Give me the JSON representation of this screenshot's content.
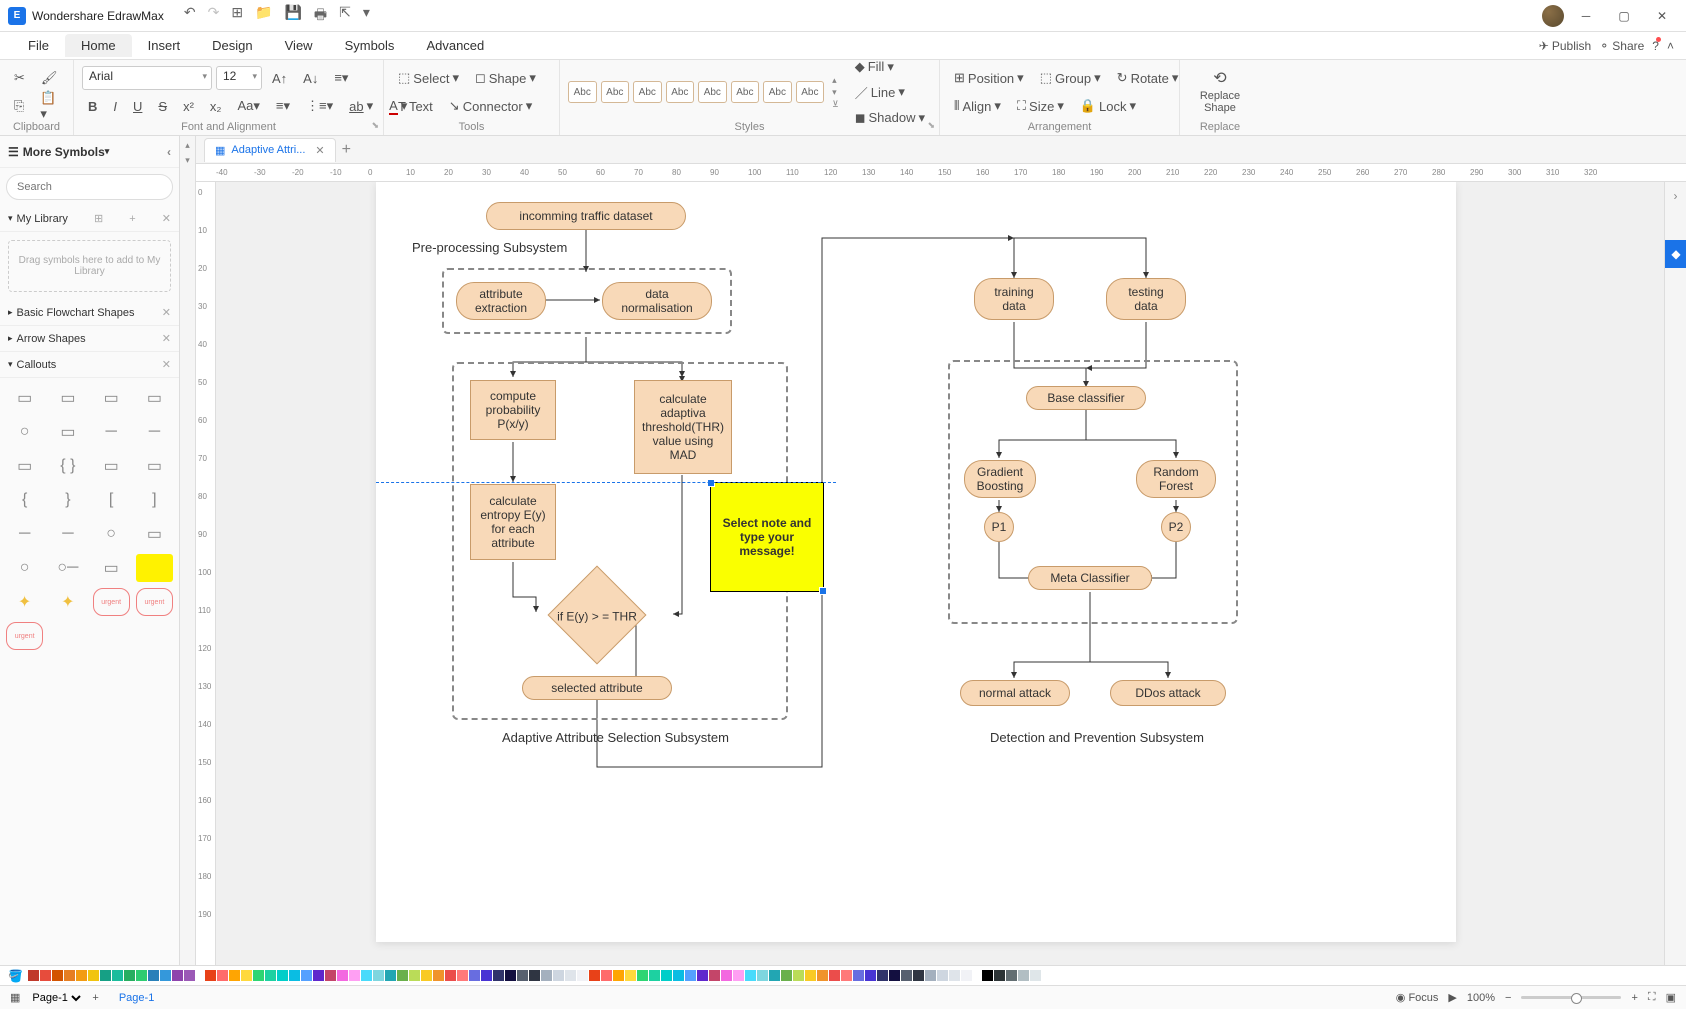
{
  "app": {
    "title": "Wondershare EdrawMax"
  },
  "menu": {
    "items": [
      "File",
      "Home",
      "Insert",
      "Design",
      "View",
      "Symbols",
      "Advanced"
    ],
    "active": "Home",
    "publish": "Publish",
    "share": "Share"
  },
  "ribbon": {
    "clipboard": {
      "label": "Clipboard"
    },
    "font": {
      "label": "Font and Alignment",
      "family": "Arial",
      "size": "12"
    },
    "tools": {
      "label": "Tools",
      "select": "Select",
      "shape": "Shape",
      "text": "Text",
      "connector": "Connector"
    },
    "styles": {
      "label": "Styles",
      "sample": "Abc",
      "fill": "Fill",
      "line": "Line",
      "shadow": "Shadow"
    },
    "arrange": {
      "label": "Arrangement",
      "position": "Position",
      "group": "Group",
      "rotate": "Rotate",
      "align": "Align",
      "size": "Size",
      "lock": "Lock"
    },
    "replace": {
      "label": "Replace",
      "button": "Replace Shape"
    }
  },
  "leftpanel": {
    "title": "More Symbols",
    "search_ph": "Search",
    "mylib": "My Library",
    "drop_hint": "Drag symbols here to add to My Library",
    "sections": {
      "basic": "Basic Flowchart Shapes",
      "arrow": "Arrow Shapes",
      "callouts": "Callouts"
    }
  },
  "tab": {
    "name": "Adaptive Attri..."
  },
  "ruler_h": [
    "-40",
    "-30",
    "-20",
    "-10",
    "0",
    "10",
    "20",
    "30",
    "40",
    "50",
    "60",
    "70",
    "80",
    "90",
    "100",
    "110",
    "120",
    "130",
    "140",
    "150",
    "160",
    "170",
    "180",
    "190",
    "200",
    "210",
    "220",
    "230",
    "240",
    "250",
    "260",
    "270",
    "280",
    "290",
    "300",
    "310",
    "320"
  ],
  "ruler_v": [
    "0",
    "10",
    "20",
    "30",
    "40",
    "50",
    "60",
    "70",
    "80",
    "90",
    "100",
    "110",
    "120",
    "130",
    "140",
    "150",
    "160",
    "170",
    "180",
    "190"
  ],
  "flowchart": {
    "incoming": "incomming traffic dataset",
    "preproc_label": "Pre-processing Subsystem",
    "attr_ext": "attribute extraction",
    "data_norm": "data normalisation",
    "compute_prob": "compute probability P(x/y)",
    "calc_thr": "calculate adaptiva threshold(THR) value using MAD",
    "calc_entropy": "calculate entropy E(y) for each attribute",
    "decision": "if E(y) > = THR",
    "selected_attr": "selected attribute",
    "adaptive_label": "Adaptive Attribute Selection Subsystem",
    "note": "Select note and type your message!",
    "training": "training data",
    "testing": "testing data",
    "base_cls": "Base classifier",
    "grad_boost": "Gradient Boosting",
    "rand_forest": "Random Forest",
    "p1": "P1",
    "p2": "P2",
    "meta_cls": "Meta Classifier",
    "normal": "normal attack",
    "ddos": "DDos attack",
    "detect_label": "Detection and Prevention Subsystem"
  },
  "status": {
    "page_sel": "Page-1",
    "page_active": "Page-1",
    "focus": "Focus",
    "zoom": "100%"
  },
  "colors_a": [
    "#c0392b",
    "#e74c3c",
    "#d35400",
    "#e67e22",
    "#f39c12",
    "#f1c40f",
    "#16a085",
    "#1abc9c",
    "#27ae60",
    "#2ecc71",
    "#2980b9",
    "#3498db",
    "#8e44ad",
    "#9b59b6"
  ],
  "colors_b": [
    "#e84118",
    "#ff6b6b",
    "#ffa502",
    "#ffd93d",
    "#2ed573",
    "#1dd1a1",
    "#00cec9",
    "#0abde3",
    "#54a0ff",
    "#5f27cd",
    "#c44569",
    "#f368e0",
    "#ff9ff3",
    "#48dbfb",
    "#7ed6df",
    "#22a6b3",
    "#6ab04c",
    "#badc58",
    "#f9ca24",
    "#f0932b",
    "#eb4d4b",
    "#ff7979",
    "#686de0",
    "#4834d4",
    "#30336b",
    "#130f40",
    "#57606f",
    "#2f3542",
    "#a4b0be",
    "#ced6e0",
    "#dfe4ea",
    "#f1f2f6"
  ],
  "colors_c": [
    "#000000",
    "#2d3436",
    "#636e72",
    "#b2bec3",
    "#dfe6e9",
    "#ffffff"
  ]
}
